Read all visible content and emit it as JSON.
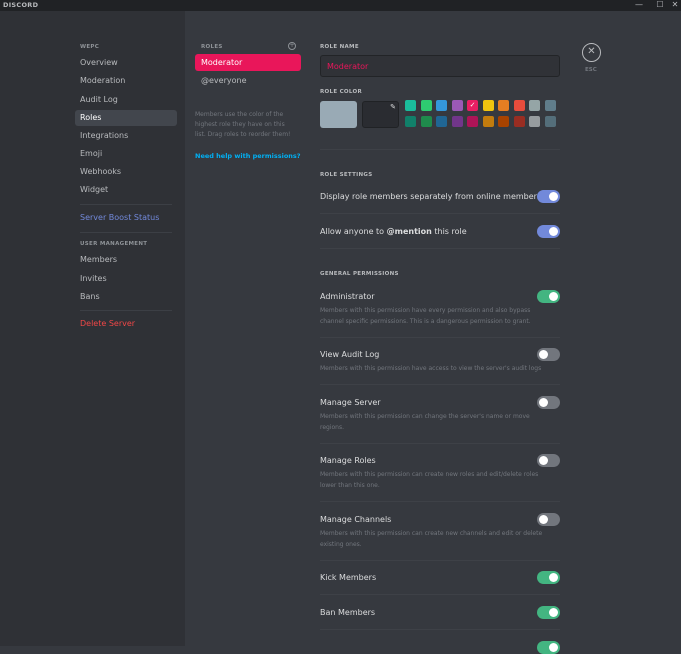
{
  "titlebar": {
    "brand": "DISCORD",
    "controls": {
      "minimize": "—",
      "maximize": "☐",
      "close": "✕"
    }
  },
  "sidebar": {
    "server_header": "WEPC",
    "items": [
      {
        "label": "Overview"
      },
      {
        "label": "Moderation"
      },
      {
        "label": "Audit Log"
      },
      {
        "label": "Roles"
      },
      {
        "label": "Integrations"
      },
      {
        "label": "Emoji"
      },
      {
        "label": "Webhooks"
      },
      {
        "label": "Widget"
      }
    ],
    "boost_label": "Server Boost Status",
    "user_mgmt_header": "USER MANAGEMENT",
    "user_items": [
      {
        "label": "Members"
      },
      {
        "label": "Invites"
      },
      {
        "label": "Bans"
      }
    ],
    "delete_label": "Delete Server"
  },
  "roles": {
    "header": "ROLES",
    "add_icon": "+",
    "items": [
      {
        "label": "Moderator"
      },
      {
        "label": "@everyone"
      }
    ],
    "help_text": "Members use the color of the highest role they have on this list. Drag roles to reorder them!",
    "help_link": "Need help with permissions?"
  },
  "main": {
    "role_name_title": "ROLE NAME",
    "role_name_value": "Moderator",
    "role_color_title": "ROLE COLOR",
    "color_current": "#99aab5",
    "swatches_row1": [
      "#1abc9c",
      "#2ecc71",
      "#3498db",
      "#9b59b6",
      "#e91e63",
      "#f1c40f",
      "#e67e22",
      "#e74c3c",
      "#95a5a6",
      "#607d8b"
    ],
    "swatches_row2": [
      "#11806a",
      "#1f8b4c",
      "#206694",
      "#71368a",
      "#ad1457",
      "#c27c0e",
      "#a84300",
      "#992d22",
      "#979c9f",
      "#546e7a"
    ],
    "selected_swatch_mark": "✓",
    "role_settings_title": "ROLE SETTINGS",
    "setting_hoist": "Display role members separately from online members",
    "setting_mention_prefix": "Allow anyone to ",
    "setting_mention_bold": "@mention",
    "setting_mention_suffix": " this role",
    "general_permissions_title": "GENERAL PERMISSIONS",
    "permissions": [
      {
        "label": "Administrator",
        "desc": "Members with this permission have every permission and also bypass channel specific permissions. This is a dangerous permission to grant.",
        "enabled": true
      },
      {
        "label": "View Audit Log",
        "desc": "Members with this permission have access to view the server's audit logs",
        "enabled": false
      },
      {
        "label": "Manage Server",
        "desc": "Members with this permission can change the server's name or move regions.",
        "enabled": false
      },
      {
        "label": "Manage Roles",
        "desc": "Members with this permission can create new roles and edit/delete roles lower than this one.",
        "enabled": false
      },
      {
        "label": "Manage Channels",
        "desc": "Members with this permission can create new channels and edit or delete existing ones.",
        "enabled": false
      },
      {
        "label": "Kick Members",
        "desc": "",
        "enabled": true
      },
      {
        "label": "Ban Members",
        "desc": "",
        "enabled": true
      }
    ]
  },
  "close": {
    "icon": "✕",
    "label": "ESC"
  },
  "colors": {
    "accent": "#e9165a",
    "blurple": "#7289da",
    "green": "#43b581",
    "danger": "#f04747"
  }
}
